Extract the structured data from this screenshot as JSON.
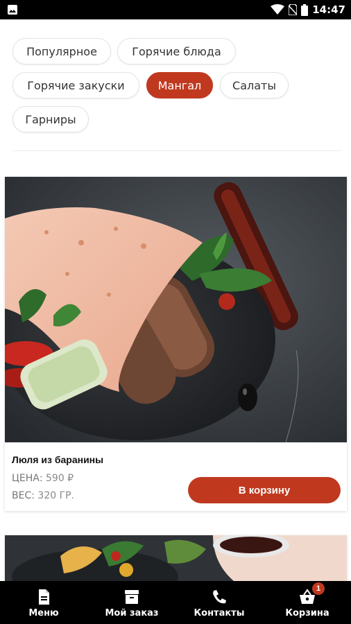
{
  "status_bar": {
    "time": "14:47"
  },
  "categories": [
    {
      "label": "Популярное",
      "active": false
    },
    {
      "label": "Горячие блюда",
      "active": false
    },
    {
      "label": "Горячие закуски",
      "active": false
    },
    {
      "label": "Мангал",
      "active": true
    },
    {
      "label": "Салаты",
      "active": false
    },
    {
      "label": "Гарниры",
      "active": false
    }
  ],
  "products": [
    {
      "title": "Люля из баранины",
      "price_label": "ЦЕНА:",
      "price_value": "590 ₽",
      "weight_label": "ВЕС:",
      "weight_value": "320 ГР.",
      "button_label": "В корзину"
    }
  ],
  "bottom_nav": {
    "items": [
      {
        "label": "Меню",
        "icon": "document-icon"
      },
      {
        "label": "Мой заказ",
        "icon": "archive-box-icon"
      },
      {
        "label": "Контакты",
        "icon": "phone-icon"
      },
      {
        "label": "Корзина",
        "icon": "basket-icon",
        "badge": "1"
      }
    ]
  },
  "colors": {
    "accent": "#c0391f",
    "nav_background": "#000000"
  }
}
